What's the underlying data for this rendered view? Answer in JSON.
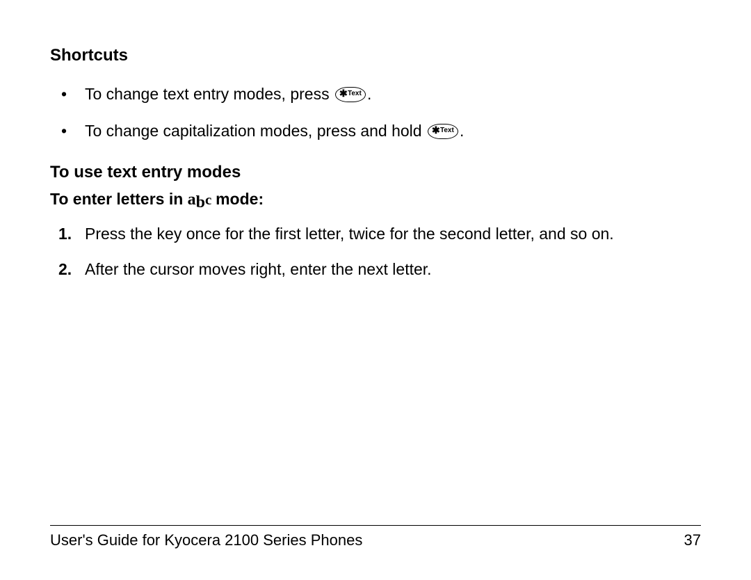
{
  "headings": {
    "shortcuts": "Shortcuts",
    "use_modes": "To use text entry modes",
    "enter_letters_pre": "To enter letters in",
    "enter_letters_post": "mode:"
  },
  "abc": {
    "a": "a",
    "b": "b",
    "c": "c"
  },
  "key": {
    "symbol": "✱",
    "label": "Text"
  },
  "bullets": {
    "b1_pre": "To change text entry modes, press",
    "b1_post": ".",
    "b2_pre": "To change capitalization modes, press and hold",
    "b2_post": "."
  },
  "steps": {
    "s1_num": "1.",
    "s1_text": "Press the key once for the first letter, twice for the second letter, and so on.",
    "s2_num": "2.",
    "s2_text": "After the cursor moves right, enter the next letter."
  },
  "footer": {
    "title": "User's Guide for Kyocera 2100 Series Phones",
    "page": "37"
  }
}
